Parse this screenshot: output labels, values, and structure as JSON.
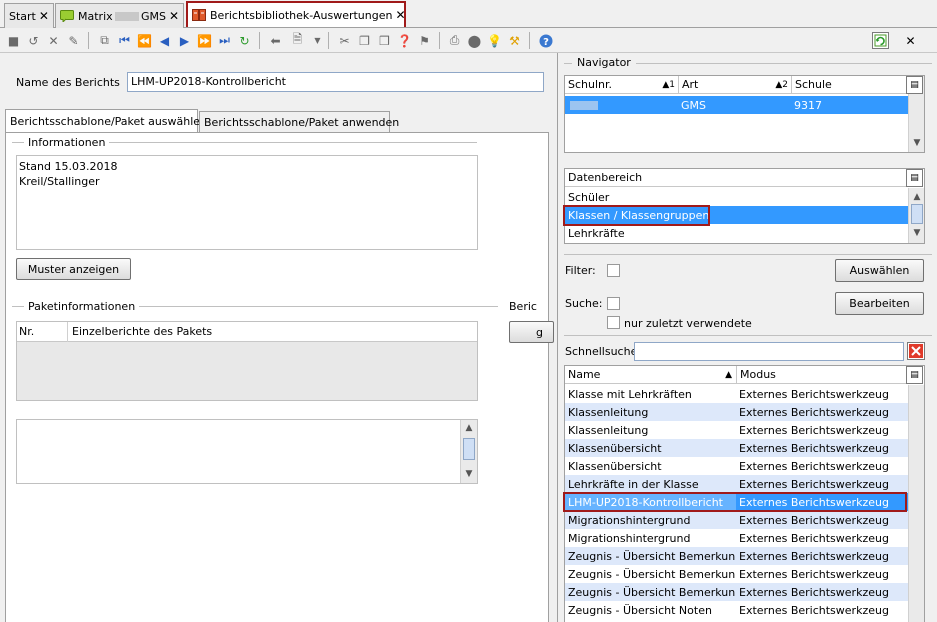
{
  "tabs": [
    {
      "label": "Start",
      "close": "✕"
    },
    {
      "label_a": "Matrix",
      "label_b": "GMS",
      "close": "✕"
    },
    {
      "label": "Berichtsbibliothek-Auswertungen",
      "close": "✕"
    }
  ],
  "toolbar": {
    "refresh_icon": "refresh-green-icon",
    "close_label": "✕",
    "help_icon": "help-icon"
  },
  "report": {
    "name_label": "Name des Berichts",
    "name_value": "LHM-UP2018-Kontrollbericht"
  },
  "page_tabs": [
    "Berichtsschablone/Paket auswählen",
    "Berichtsschablone/Paket anwenden"
  ],
  "info": {
    "title": "Informationen",
    "line1": "Stand 15.03.2018",
    "line2": "Kreil/Stallinger"
  },
  "buttons": {
    "show_sample": "Muster anzeigen",
    "select": "Auswählen",
    "edit": "Bearbeiten",
    "partial_g": "g"
  },
  "package": {
    "title": "Paketinformationen",
    "col_nr": "Nr.",
    "col_reports": "Einzelberichte des Pakets",
    "side_title": "Beric"
  },
  "navigator": {
    "title": "Navigator",
    "col_schulnr": "Schulnr.",
    "col_schulnr_sort": "▲1",
    "col_art": "Art",
    "col_art_sort": "▲2",
    "col_schule": "Schule",
    "row": {
      "schulnr": "",
      "art": "GMS",
      "schule": "9317"
    }
  },
  "datenbereich": {
    "header": "Datenbereich",
    "items": [
      "Schüler",
      "Klassen / Klassengruppen",
      "Lehrkräfte"
    ]
  },
  "filter": {
    "filter_label": "Filter:",
    "suche_label": "Suche:",
    "recent_label": "nur zuletzt verwendete"
  },
  "quicksearch": {
    "label": "Schnellsuche",
    "value": ""
  },
  "reports": {
    "col_name": "Name",
    "col_name_sort": "▲",
    "col_modus": "Modus",
    "rows": [
      {
        "name": "Klasse mit Lehrkräften",
        "modus": "Externes Berichtswerkzeug"
      },
      {
        "name": "Klassenleitung",
        "modus": "Externes Berichtswerkzeug"
      },
      {
        "name": "Klassenleitung",
        "modus": "Externes Berichtswerkzeug"
      },
      {
        "name": "Klassenübersicht",
        "modus": "Externes Berichtswerkzeug"
      },
      {
        "name": "Klassenübersicht",
        "modus": "Externes Berichtswerkzeug"
      },
      {
        "name": "Lehrkräfte in der Klasse",
        "modus": "Externes Berichtswerkzeug"
      },
      {
        "name": "LHM-UP2018-Kontrollbericht",
        "modus": "Externes Berichtswerkzeug"
      },
      {
        "name": "Migrationshintergrund",
        "modus": "Externes Berichtswerkzeug"
      },
      {
        "name": "Migrationshintergrund",
        "modus": "Externes Berichtswerkzeug"
      },
      {
        "name": "Zeugnis - Übersicht Bemerkun...",
        "modus": "Externes Berichtswerkzeug"
      },
      {
        "name": "Zeugnis - Übersicht Bemerkun...",
        "modus": "Externes Berichtswerkzeug"
      },
      {
        "name": "Zeugnis - Übersicht Bemerkun...",
        "modus": "Externes Berichtswerkzeug"
      },
      {
        "name": "Zeugnis - Übersicht Noten",
        "modus": "Externes Berichtswerkzeug"
      }
    ]
  },
  "colors": {
    "selection": "#3399ff",
    "highlight_border": "#a01a1a",
    "alt_row": "#dde8fa"
  }
}
